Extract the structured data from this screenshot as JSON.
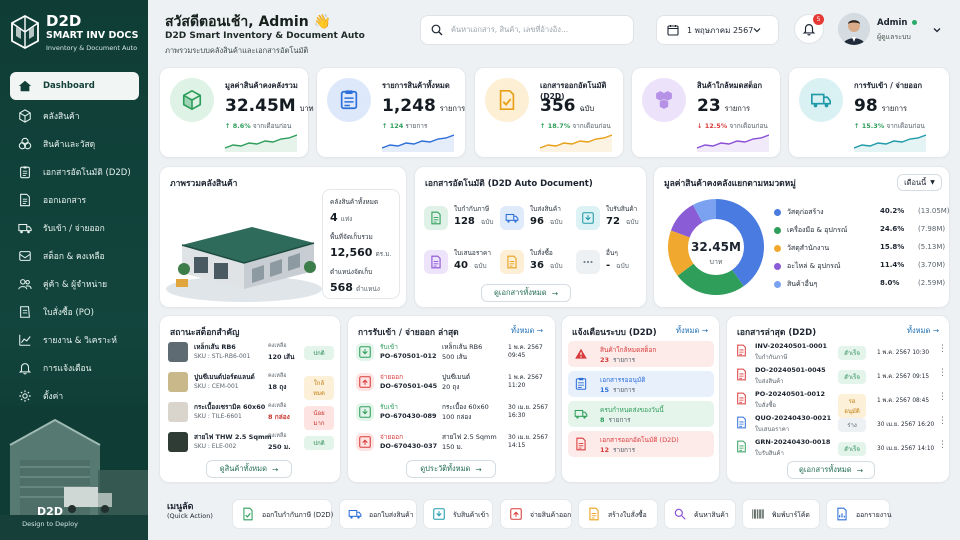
{
  "app": {
    "name": "D2D",
    "name2": "SMART INV DOCS",
    "tagline": "Inventory & Document Auto",
    "brand": "D2D",
    "brand_tagline": "Design to Deploy"
  },
  "sidebar": {
    "items": [
      {
        "label": "Dashboard",
        "icon": "home-icon",
        "active": true
      },
      {
        "label": "คลังสินค้า",
        "icon": "cube-icon"
      },
      {
        "label": "สินค้าและวัสดุ",
        "icon": "boxes-icon"
      },
      {
        "label": "เอกสารอัตโนมัติ (D2D)",
        "icon": "clipboard-icon"
      },
      {
        "label": "ออกเอกสาร",
        "icon": "document-icon"
      },
      {
        "label": "รับเข้า / จ่ายออก",
        "icon": "truck-icon"
      },
      {
        "label": "สต็อก & คงเหลือ",
        "icon": "stock-icon"
      },
      {
        "label": "คู่ค้า & ผู้จำหน่าย",
        "icon": "users-icon"
      },
      {
        "label": "ใบสั่งซื้อ (PO)",
        "icon": "cart-icon"
      },
      {
        "label": "รายงาน & วิเคราะห์",
        "icon": "chart-icon"
      },
      {
        "label": "การแจ้งเตือน",
        "icon": "bell-icon"
      },
      {
        "label": "ตั้งค่า",
        "icon": "gear-icon"
      }
    ]
  },
  "header": {
    "greeting": "สวัสดีตอนเช้า, Admin 👋",
    "subtitle": "D2D Smart Inventory & Document Auto",
    "caption": "ภาพรวมระบบคลังสินค้าและเอกสารอัตโนมัติ",
    "search_placeholder": "ค้นหาเอกสาร, สินค้า, เลขที่อ้างอิง...",
    "date": "1 พฤษภาคม 2567",
    "notif_count": "5",
    "user_name": "Admin",
    "user_role": "ผู้ดูแลระบบ"
  },
  "kpis": [
    {
      "label": "มูลค่าสินค้าคงคลังรวม",
      "value": "32.45M",
      "unit": "บาท",
      "dir": "up",
      "delta": "8.6%",
      "note": "จากเดือนก่อน",
      "color": "#2f9e5b",
      "bg": "#def2e6",
      "icon": "cube-icon"
    },
    {
      "label": "รายการสินค้าทั้งหมด",
      "value": "1,248",
      "unit": "รายการ",
      "dir": "up",
      "delta": "124",
      "note": "รายการ",
      "color": "#2d6fd8",
      "bg": "#dde9fb",
      "icon": "list-icon"
    },
    {
      "label": "เอกสารออกอัตโนมัติ (D2D)",
      "value": "356",
      "unit": "ฉบับ",
      "dir": "up",
      "delta": "18.7%",
      "note": "จากเดือนก่อน",
      "color": "#e8a019",
      "bg": "#fcefd3",
      "icon": "doc-check-icon"
    },
    {
      "label": "สินค้าใกล้หมดสต็อก",
      "value": "23",
      "unit": "รายการ",
      "dir": "down",
      "delta": "12.5%",
      "note": "จากเดือนก่อน",
      "color": "#8a4fd6",
      "bg": "#ece2fa",
      "icon": "cubes-icon"
    },
    {
      "label": "การรับเข้า / จ่ายออก",
      "value": "98",
      "unit": "รายการ",
      "dir": "up",
      "delta": "15.3%",
      "note": "จากเดือนก่อน",
      "color": "#1f9aa8",
      "bg": "#d9f1f3",
      "icon": "truck-icon"
    }
  ],
  "warehouse": {
    "title": "ภาพรวมคลังสินค้า",
    "stats": [
      {
        "label": "คลังสินค้าทั้งหมด",
        "value": "4",
        "unit": "แห่ง"
      },
      {
        "label": "พื้นที่จัดเก็บรวม",
        "value": "12,560",
        "unit": "ตร.ม."
      },
      {
        "label": "ตำแหน่งจัดเก็บ",
        "value": "568",
        "unit": "ตำแหน่ง"
      }
    ]
  },
  "autodocs": {
    "title": "เอกสารอัตโนมัติ (D2D Auto Document)",
    "items": [
      {
        "label": "ใบกำกับภาษี",
        "value": "128",
        "unit": "ฉบับ",
        "color": "#2f9e5b",
        "bg": "#e0f2e7"
      },
      {
        "label": "ใบส่งสินค้า",
        "value": "96",
        "unit": "ฉบับ",
        "color": "#2d6fd8",
        "bg": "#dfeafb"
      },
      {
        "label": "ใบรับสินค้า",
        "value": "72",
        "unit": "ฉบับ",
        "color": "#1f9aa8",
        "bg": "#dcf2f4"
      },
      {
        "label": "ใบเสนอราคา",
        "value": "40",
        "unit": "ฉบับ",
        "color": "#8a4fd6",
        "bg": "#ede3fa"
      },
      {
        "label": "ใบสั่งซื้อ",
        "value": "36",
        "unit": "ฉบับ",
        "color": "#e8a019",
        "bg": "#fcefd5"
      },
      {
        "label": "อื่นๆ",
        "value": "-",
        "unit": "ฉบับ",
        "color": "#6b767f",
        "bg": "#eef1f4"
      }
    ],
    "button": "ดูเอกสารทั้งหมด"
  },
  "category": {
    "title": "มูลค่าสินค้าคงคลังแยกตามหมวดหมู่",
    "period": "เดือนนี้",
    "center_value": "32.45M",
    "center_unit": "บาท"
  },
  "chart_data": {
    "type": "pie",
    "categories": [
      "วัสดุก่อสร้าง",
      "เครื่องมือ & อุปกรณ์",
      "วัสดุสำนักงาน",
      "อะไหล่ & อุปกรณ์",
      "สินค้าอื่นๆ"
    ],
    "values": [
      40.2,
      24.6,
      15.8,
      11.4,
      8.0
    ],
    "percent_labels": [
      "40.2%",
      "24.6%",
      "15.8%",
      "11.4%",
      "8.0%"
    ],
    "amount_labels": [
      "(13.05M)",
      "(7.98M)",
      "(5.13M)",
      "(3.70M)",
      "(2.59M)"
    ],
    "colors": [
      "#4a7be0",
      "#2f9e5b",
      "#f0a92e",
      "#8a5cd6",
      "#7aa2f0"
    ]
  },
  "stock": {
    "title": "สถานะสต็อกสำคัญ",
    "items": [
      {
        "name": "เหล็กเส้น RB6",
        "sku": "SKU : STL-RB6-001",
        "qty_label": "คงเหลือ",
        "qty": "120 เส้น",
        "status": "ปกติ",
        "cls": "ok"
      },
      {
        "name": "ปูนซีเมนต์ปอร์ตแลนด์",
        "sku": "SKU : CEM-001",
        "qty_label": "คงเหลือ",
        "qty": "18 ถุง",
        "status": "ใกล้หมด",
        "cls": "warn"
      },
      {
        "name": "กระเบื้องเซรามิค 60x60",
        "sku": "SKU : TILE-6601",
        "qty_label": "คงเหลือ",
        "qty": "8 กล่อง",
        "status": "น้อยมาก",
        "cls": "bad"
      },
      {
        "name": "สายไฟ THW 2.5 Sqmm",
        "sku": "SKU : ELE-002",
        "qty_label": "คงเหลือ",
        "qty": "250 ม.",
        "status": "ปกติ",
        "cls": "ok"
      }
    ],
    "button": "ดูสินค้าทั้งหมด"
  },
  "movements": {
    "title": "การรับเข้า / จ่ายออก ล่าสุด",
    "link": "ทั้งหมด",
    "items": [
      {
        "type": "รับเข้า",
        "doc": "PO-670501-012",
        "item": "เหล็กเส้น RB6",
        "qty": "500 เส้น",
        "date": "1 พ.ค. 2567",
        "time": "09:45",
        "kind": "in"
      },
      {
        "type": "จ่ายออก",
        "doc": "DO-670501-045",
        "item": "ปูนซีเมนต์",
        "qty": "20 ถุง",
        "date": "1 พ.ค. 2567",
        "time": "11:20",
        "kind": "out"
      },
      {
        "type": "รับเข้า",
        "doc": "PO-670430-089",
        "item": "กระเบื้อง 60x60",
        "qty": "100 กล่อง",
        "date": "30 เม.ย. 2567",
        "time": "16:30",
        "kind": "in"
      },
      {
        "type": "จ่ายออก",
        "doc": "DO-670430-037",
        "item": "สายไฟ 2.5 Sqmm",
        "qty": "150 ม.",
        "date": "30 เม.ย. 2567",
        "time": "14:15",
        "kind": "out"
      }
    ],
    "button": "ดูประวัติทั้งหมด"
  },
  "alerts": {
    "title": "แจ้งเตือนระบบ (D2D)",
    "link": "ทั้งหมด",
    "items": [
      {
        "title": "สินค้าใกล้หมดสต็อก",
        "count": "23",
        "unit": "รายการ",
        "color": "#d93b3b",
        "bg": "#fdebea"
      },
      {
        "title": "เอกสารรออนุมัติ",
        "count": "15",
        "unit": "รายการ",
        "color": "#2d6fd8",
        "bg": "#e8f0fc"
      },
      {
        "title": "ครบกำหนดส่งของวันนี้",
        "count": "8",
        "unit": "รายการ",
        "color": "#2f9e5b",
        "bg": "#e6f5ec"
      },
      {
        "title": "เอกสารออกอัตโนมัติ (D2D)",
        "count": "12",
        "unit": "รายการ",
        "color": "#d93b3b",
        "bg": "#fdebea"
      }
    ]
  },
  "recentdocs": {
    "title": "เอกสารล่าสุด (D2D)",
    "link": "ทั้งหมด",
    "items": [
      {
        "no": "INV-20240501-0001",
        "type": "ใบกำกับภาษี",
        "status": "สำเร็จ",
        "cls": "ok",
        "date": "1 พ.ค. 2567 10:30",
        "color": "#d93b3b"
      },
      {
        "no": "DO-20240501-0045",
        "type": "ใบส่งสินค้า",
        "status": "สำเร็จ",
        "cls": "ok",
        "date": "1 พ.ค. 2567 09:15",
        "color": "#d93b3b"
      },
      {
        "no": "PO-20240501-0012",
        "type": "ใบสั่งซื้อ",
        "status": "รออนุมัติ",
        "cls": "warn",
        "date": "1 พ.ค. 2567 08:45",
        "color": "#d93b3b"
      },
      {
        "no": "QUO-20240430-0021",
        "type": "ใบเสนอราคา",
        "status": "ร่าง",
        "cls": "gray",
        "date": "30 เม.ย. 2567 16:20",
        "color": "#2d6fd8"
      },
      {
        "no": "GRN-20240430-0018",
        "type": "ใบรับสินค้า",
        "status": "สำเร็จ",
        "cls": "ok",
        "date": "30 เม.ย. 2567 14:10",
        "color": "#2f9e5b"
      }
    ],
    "button": "ดูเอกสารทั้งหมด"
  },
  "quick": {
    "title": "เมนูลัด",
    "subtitle": "(Quick Action)",
    "items": [
      {
        "label": "ออกใบกำกับภาษี (D2D)",
        "color": "#2f9e5b"
      },
      {
        "label": "ออกใบส่งสินค้า",
        "color": "#2d6fd8"
      },
      {
        "label": "รับสินค้าเข้า",
        "color": "#1f9aa8"
      },
      {
        "label": "จ่ายสินค้าออก",
        "color": "#d93b3b"
      },
      {
        "label": "สร้างใบสั่งซื้อ",
        "color": "#e8a019"
      },
      {
        "label": "ค้นหาสินค้า",
        "color": "#8a4fd6"
      },
      {
        "label": "พิมพ์บาร์โค้ด",
        "color": "#4b5851"
      },
      {
        "label": "ออกรายงาน",
        "color": "#2d6fd8"
      }
    ]
  }
}
